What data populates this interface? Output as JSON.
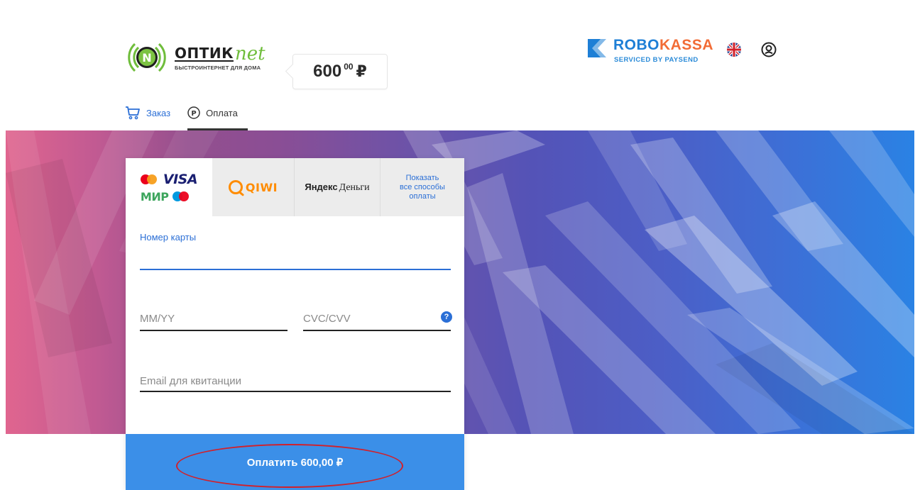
{
  "merchant": {
    "name_part1": "ОПТИК",
    "name_part2": "net",
    "tagline": "БЫСТРОИНТЕРНЕТ ДЛЯ ДОМА",
    "logo_letter": "N"
  },
  "order": {
    "amount_int": "600",
    "amount_frac": "00",
    "currency": "₽"
  },
  "provider": {
    "name_part1": "ROBO",
    "name_part2": "KASSA",
    "serviced_by": "SERVICED BY PAYSEND"
  },
  "header": {
    "language_icon": "uk-flag-icon",
    "account_icon": "user-circle-icon"
  },
  "nav": {
    "order_label": "Заказ",
    "pay_label": "Оплата",
    "active": "pay"
  },
  "methods": {
    "cards": {
      "visa": "VISA",
      "mir": "МИР"
    },
    "qiwi": "QIWI",
    "yandex_part1": "Яндекс",
    "yandex_part2": "Деньги",
    "all_line1": "Показать",
    "all_line2": "все способы",
    "all_line3": "оплаты"
  },
  "form": {
    "card_number_label": "Номер карты",
    "card_number_value": "",
    "expiry_placeholder": "MM/YY",
    "cvc_placeholder": "CVC/CVV",
    "email_placeholder": "Email для квитанции",
    "help_glyph": "?"
  },
  "pay_button": {
    "label": "Оплатить 600,00 ₽"
  },
  "colors": {
    "primary": "#3b8fe8",
    "link": "#2b6fd6",
    "robo_blue": "#1e7fd6",
    "robo_orange": "#f26c36",
    "highlight": "#d2202a"
  }
}
